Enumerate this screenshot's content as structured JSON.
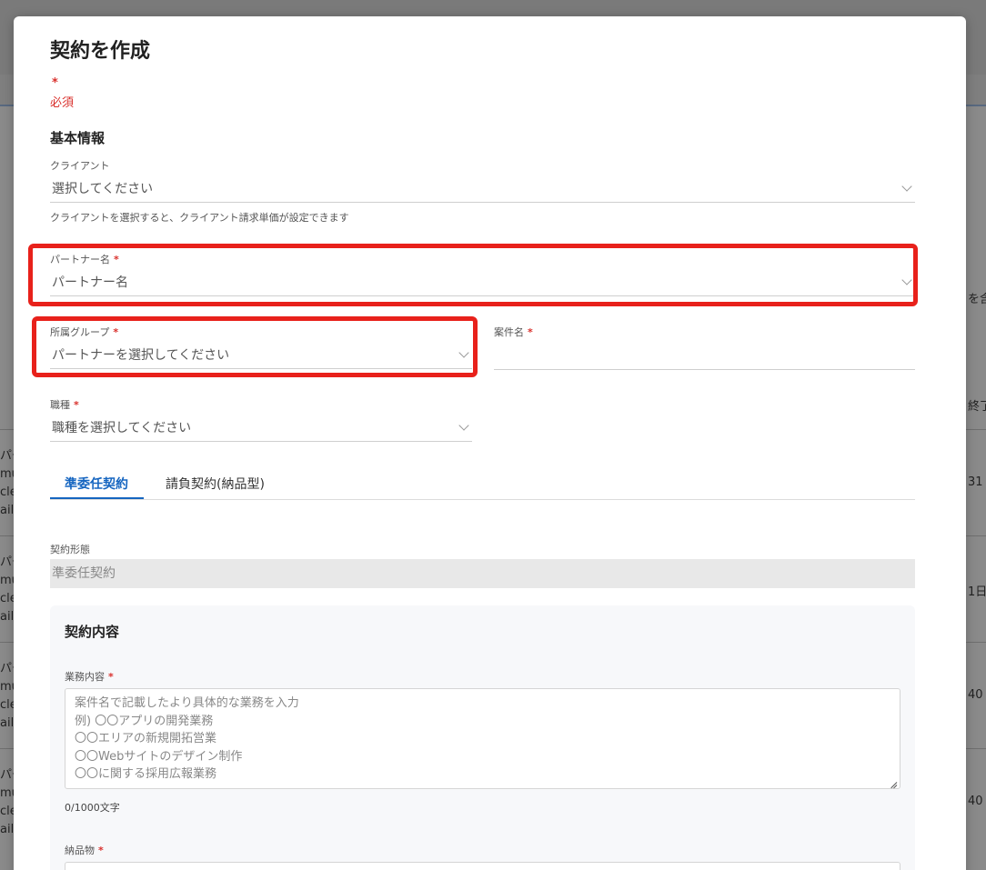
{
  "modal": {
    "title": "契約を作成",
    "required_star": "*",
    "required_note": "必須",
    "section_basic": "基本情報",
    "client": {
      "label": "クライアント",
      "value": "選択してください",
      "helper": "クライアントを選択すると、クライアント請求単価が設定できます"
    },
    "partner": {
      "label": "パートナー名",
      "star": "*",
      "value": "パートナー名"
    },
    "group": {
      "label": "所属グループ",
      "star": "*",
      "value": "パートナーを選択してください"
    },
    "project": {
      "label": "案件名",
      "star": "*",
      "value": ""
    },
    "job": {
      "label": "職種",
      "star": "*",
      "value": "職種を選択してください"
    },
    "tabs": [
      {
        "label": "準委任契約",
        "active": true
      },
      {
        "label": "請負契約(納品型)",
        "active": false
      }
    ],
    "contract_type": {
      "label": "契約形態",
      "value": "準委任契約"
    },
    "contract_card": {
      "title": "契約内容",
      "work": {
        "label": "業務内容",
        "star": "*",
        "placeholder_lines": [
          "案件名で記載したより具体的な業務を入力",
          "例) 〇〇アプリの開発業務",
          "〇〇エリアの新規開拓営業",
          "〇〇Webサイトのデザイン制作",
          "〇〇に関する採用広報業務"
        ],
        "counter": "0/1000文字"
      },
      "deliverable": {
        "label": "納品物",
        "star": "*"
      }
    }
  },
  "background": {
    "left_fragments": [
      "パー",
      "mu",
      "cle",
      "ail.",
      "パー",
      "mu",
      "cle",
      "ail.",
      "パー",
      "mu",
      "cle",
      "ail.",
      "パー",
      "mu",
      "cle",
      "ail."
    ],
    "right_fragments": [
      "を含",
      "終了",
      "31",
      "1日",
      "40",
      "40"
    ]
  },
  "colors": {
    "accent": "#1565c0",
    "required": "#d9302c",
    "highlight": "#e8211b",
    "overlay": "#7f7f7f"
  }
}
